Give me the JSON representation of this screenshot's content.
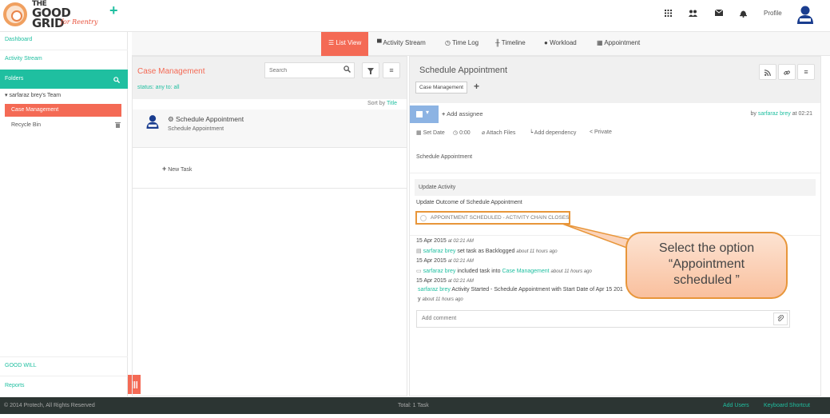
{
  "brand": {
    "logo_line1": "THE",
    "logo_line2": "GOOD",
    "logo_line3": "GRID",
    "logo_sub": "for Reentry"
  },
  "topbar": {
    "profile_label": "Profile",
    "icons": [
      "apps-grid-icon",
      "users-icon",
      "mail-icon",
      "bell-icon"
    ]
  },
  "sidebar": {
    "dashboard": "Dashboard",
    "activity_stream": "Activity Stream",
    "folders": "Folders",
    "team": "sarfaraz brey's Team",
    "case_management": "Case Management",
    "recycle_bin": "Recycle Bin",
    "good_will": "GOOD WILL",
    "reports": "Reports"
  },
  "tabs": {
    "list_view": "List View",
    "activity_stream": "Activity Stream",
    "time_log": "Time Log",
    "timeline": "Timeline",
    "workload": "Workload",
    "appointment": "Appointment"
  },
  "middle": {
    "title": "Case Management",
    "status": "status: any   to: all",
    "search_placeholder": "Search",
    "sort_by": "Sort by",
    "sort_field": "Title",
    "task_title": "Schedule Appointment",
    "task_sub": "Schedule Appointment",
    "new_task": "New Task"
  },
  "detail": {
    "title": "Schedule Appointment",
    "tag": "Case Management",
    "add_assignee": "Add assignee",
    "by_prefix": "by",
    "by_user": "sarfaraz brey",
    "by_time": "at 02:21",
    "set_date": "Set Date",
    "time_value": "0:00",
    "attach_files": "Attach Files",
    "add_dependency": "Add dependency",
    "private": "Private",
    "description": "Schedule Appointment",
    "update_activity": "Update Activity",
    "update_outcome": "Update Outcome of Schedule Appointment",
    "option_label": "APPOINTMENT SCHEDULED - ACTIVITY CHAIN CLOSES",
    "comment_placeholder": "Add comment"
  },
  "log": [
    {
      "date": "15 Apr 2015",
      "time": "at 02:21 AM",
      "user": "sarfaraz brey",
      "text": "set task as Backlogged",
      "ago": "about 11 hours ago"
    },
    {
      "date": "15 Apr 2015",
      "time": "at 02:21 AM",
      "user": "sarfaraz brey",
      "text": "included task into",
      "link": "Case Management",
      "ago": "about 11 hours ago"
    },
    {
      "date": "15 Apr 2015",
      "time": "at 02:21 AM",
      "user": "sarfaraz brey",
      "text": "Activity Started - Schedule Appointment with Start Date of Apr 15 201",
      "text2": "y",
      "ago": "about 11 hours ago"
    }
  ],
  "callout": {
    "line1": "Select the option",
    "line2": "“Appointment",
    "line3": "scheduled ”"
  },
  "footer": {
    "copyright": "© 2014 Protech, All Rights Reserved",
    "total": "Total: 1 Task",
    "add_users": "Add Users",
    "keyboard_shortcut": "Keyboard Shortcut"
  },
  "colors": {
    "accent_teal": "#1fbfa0",
    "accent_coral": "#f46a55",
    "highlight_orange": "#e8963a",
    "footer_dark": "#2c3533"
  }
}
